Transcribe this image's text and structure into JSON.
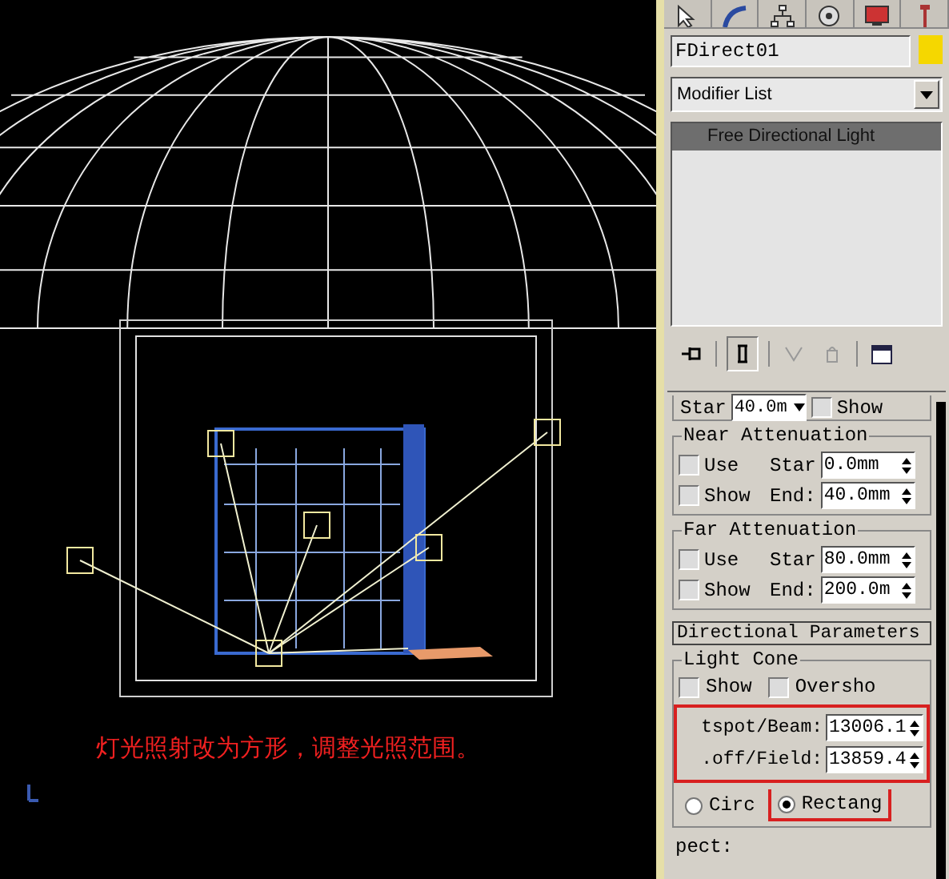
{
  "viewport": {
    "annotation": "灯光照射改为方形，调整光照范围。"
  },
  "command_panel": {
    "object_name": "FDirect01",
    "modifier_list": "Modifier List",
    "stack": [
      {
        "label": "Free Directional Light",
        "selected": true
      }
    ],
    "cut_row": {
      "start_label": "Star",
      "start_value": "40.0m",
      "show": {
        "label": "Show",
        "checked": false
      }
    },
    "attenuation": [
      {
        "title": "Near Attenuation",
        "use": {
          "label": "Use",
          "checked": false
        },
        "show": {
          "label": "Show",
          "checked": false
        },
        "start_label": "Star",
        "start_value": "0.0mm",
        "end_label": "End:",
        "end_value": "40.0mm"
      },
      {
        "title": "Far Attenuation",
        "use": {
          "label": "Use",
          "checked": false
        },
        "show": {
          "label": "Show",
          "checked": false
        },
        "start_label": "Star",
        "start_value": "80.0mm",
        "end_label": "End:",
        "end_value": "200.0m"
      }
    ],
    "directional_parameters": {
      "title": "Directional Parameters",
      "light_cone_title": "Light Cone",
      "options": [
        {
          "label": "Show",
          "checked": false
        },
        {
          "label": "Oversho",
          "checked": false
        }
      ],
      "spinners": [
        {
          "label": "tspot/Beam:",
          "value": "13006.1"
        },
        {
          "label": ".off/Field:",
          "value": "13859.4"
        }
      ],
      "shapes": [
        {
          "label": "Circ",
          "selected": false
        },
        {
          "label": "Rectang",
          "selected": true
        }
      ],
      "aspect_label": "pect:"
    }
  }
}
